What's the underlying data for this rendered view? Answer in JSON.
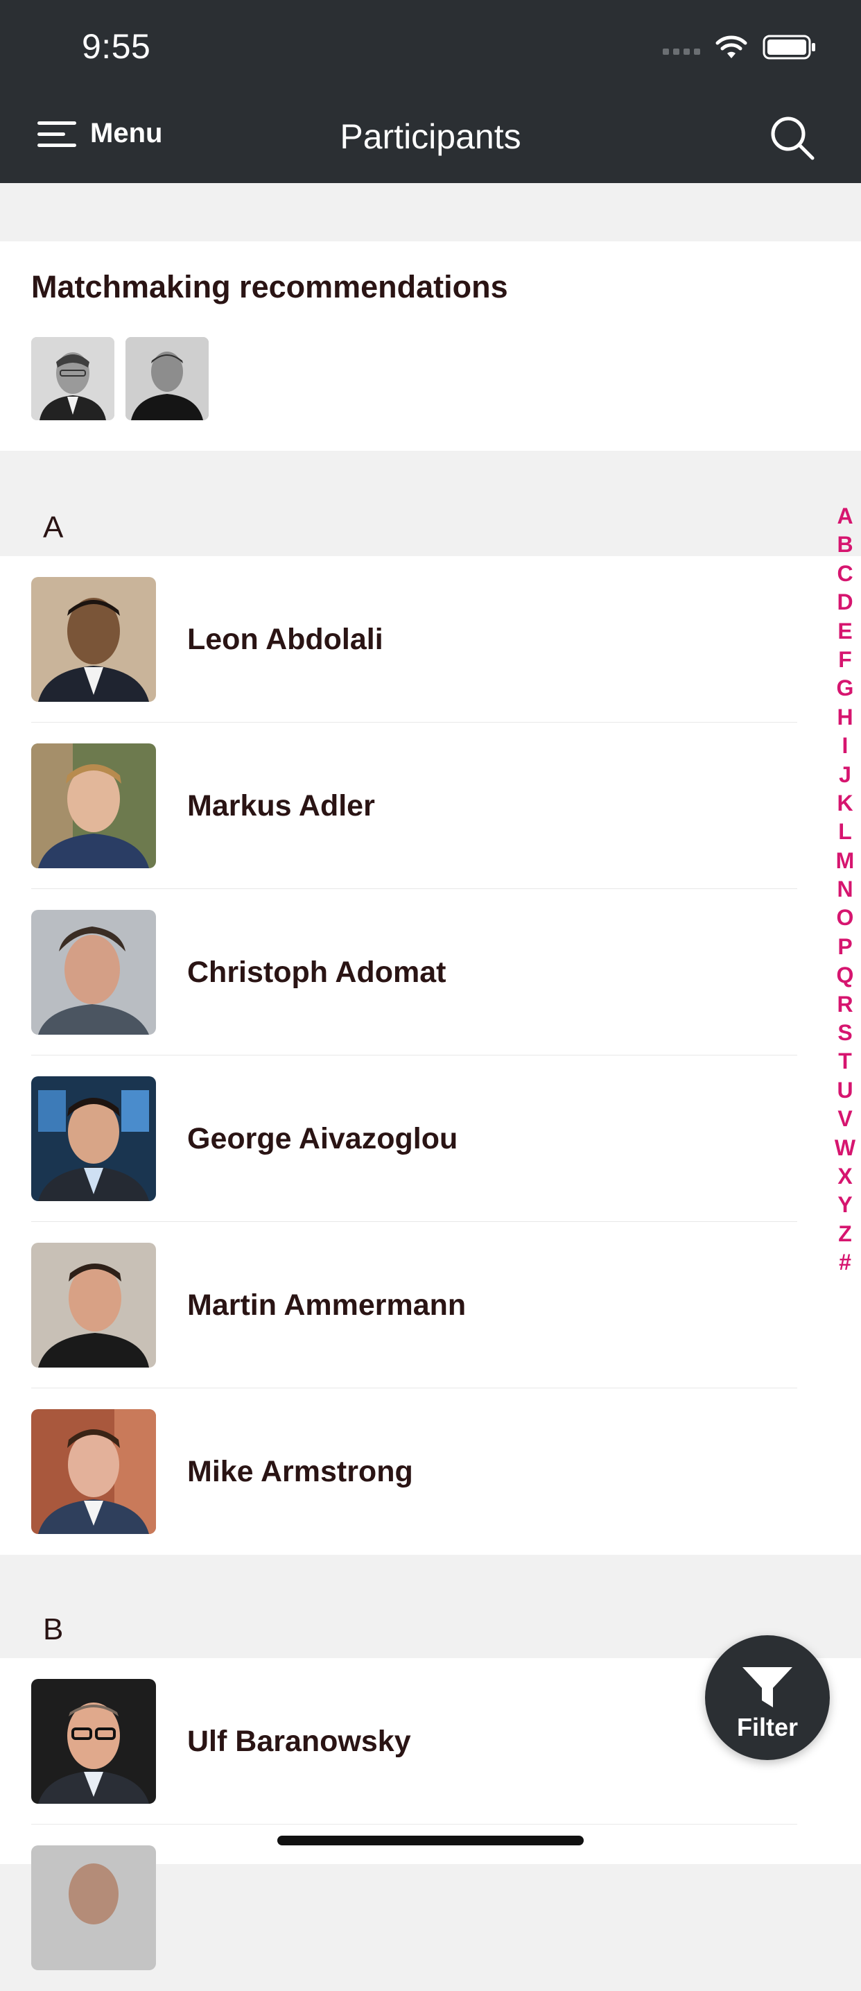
{
  "status": {
    "time": "9:55"
  },
  "header": {
    "menu_label": "Menu",
    "title": "Participants"
  },
  "matchmaking": {
    "title": "Matchmaking recommendations"
  },
  "sections": [
    {
      "letter": "A",
      "people": [
        {
          "name": "Leon Abdolali"
        },
        {
          "name": "Markus Adler"
        },
        {
          "name": "Christoph Adomat"
        },
        {
          "name": "George Aivazoglou"
        },
        {
          "name": "Martin Ammermann"
        },
        {
          "name": "Mike Armstrong"
        }
      ]
    },
    {
      "letter": "B",
      "people": [
        {
          "name": "Ulf Baranowsky"
        }
      ]
    }
  ],
  "index_letters": [
    "A",
    "B",
    "C",
    "D",
    "E",
    "F",
    "G",
    "H",
    "I",
    "J",
    "K",
    "L",
    "M",
    "N",
    "O",
    "P",
    "Q",
    "R",
    "S",
    "T",
    "U",
    "V",
    "W",
    "X",
    "Y",
    "Z",
    "#"
  ],
  "filter": {
    "label": "Filter"
  },
  "colors": {
    "header_bg": "#2b2f33",
    "accent": "#d6156f",
    "page_bg": "#f1f1f1"
  }
}
